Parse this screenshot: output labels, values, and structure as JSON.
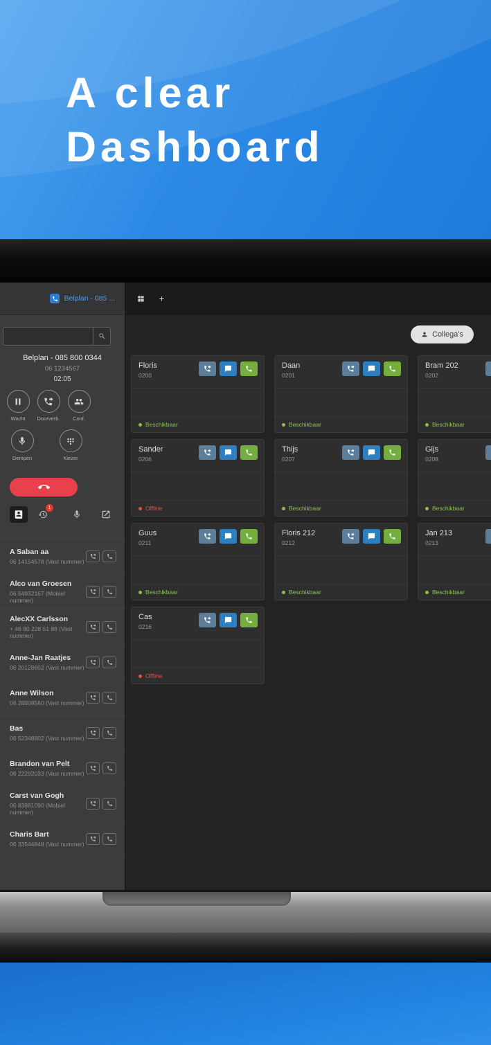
{
  "hero": {
    "title_line1": "A clear",
    "title_line2": "Dashboard"
  },
  "softphone": {
    "header_title": "Belplan - 085 ...",
    "account_name": "Belplan - 085 800 0344",
    "caller_number": "06 1234567",
    "call_timer": "02:05",
    "controls": {
      "hold_label": "Wacht",
      "transfer_label": "Doorverb.",
      "conference_label": "Conf.",
      "mute_label": "Dempen",
      "dialer_label": "Kiezer"
    },
    "history_badge": "1",
    "contacts": [
      {
        "name": "A Saban aa",
        "number": "06 14154578 (Vast nummer)"
      },
      {
        "name": "Alco van Groesen",
        "number": "06 54932167 (Mobiel nummer)"
      },
      {
        "name": "AlecXX Carlsson",
        "number": "+ 46 90 228 51 88 (Vast nummer)"
      },
      {
        "name": "Anne-Jan Raatjes",
        "number": "06 20128602 (Vast nummer)"
      },
      {
        "name": "Anne Wilson",
        "number": "06 28908560 (Vast nummer)"
      },
      {
        "name": "Bas",
        "number": "06 52348802 (Vast nummer)"
      },
      {
        "name": "Brandon van Pelt",
        "number": "06 22292033 (Vast nummer)"
      },
      {
        "name": "Carst van Gogh",
        "number": "06 83881090 (Mobiel nummer)"
      },
      {
        "name": "Charis Bart",
        "number": "06 33544848 (Vast nummer)"
      }
    ]
  },
  "dashboard": {
    "colleagues_button": "Collega's",
    "cards": [
      {
        "name": "Floris",
        "extension": "0200",
        "status": "Beschikbaar",
        "state": "available"
      },
      {
        "name": "Daan",
        "extension": "0201",
        "status": "Beschikbaar",
        "state": "available"
      },
      {
        "name": "Bram 202",
        "extension": "0202",
        "status": "Beschikbaar",
        "state": "available"
      },
      {
        "name": "Sander",
        "extension": "0206",
        "status": "Offline",
        "state": "offline"
      },
      {
        "name": "Thijs",
        "extension": "0207",
        "status": "Beschikbaar",
        "state": "available"
      },
      {
        "name": "Gijs",
        "extension": "0208",
        "status": "Beschikbaar",
        "state": "available"
      },
      {
        "name": "Guus",
        "extension": "0211",
        "status": "Beschikbaar",
        "state": "available"
      },
      {
        "name": "Floris 212",
        "extension": "0212",
        "status": "Beschikbaar",
        "state": "available"
      },
      {
        "name": "Jan 213",
        "extension": "0213",
        "status": "Beschikbaar",
        "state": "available"
      },
      {
        "name": "Cas",
        "extension": "0216",
        "status": "Offline",
        "state": "offline"
      }
    ],
    "colors": {
      "status_available": "#8cc152",
      "status_offline": "#e0524e",
      "action_gray_blue": "#5d7e9b",
      "action_blue": "#2e7fc2",
      "action_green": "#74ae3f",
      "hangup_red": "#e8414d",
      "brand_blue": "#2d7dd2"
    }
  }
}
